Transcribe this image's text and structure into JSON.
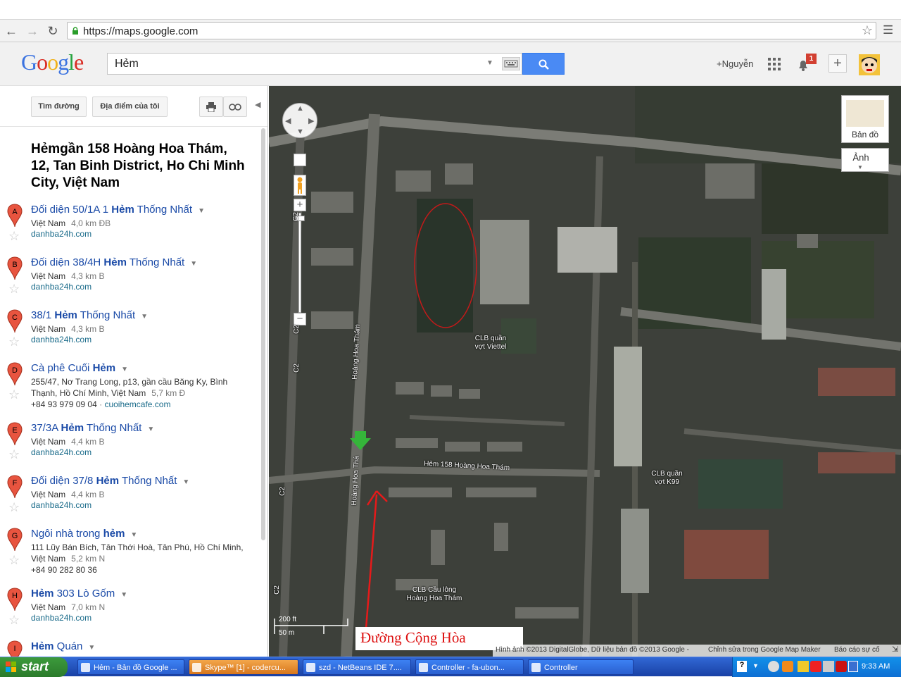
{
  "browser": {
    "url": "https://maps.google.com",
    "back_icon": "back-arrow-icon",
    "forward_icon": "forward-arrow-icon",
    "reload_icon": "reload-icon",
    "star_icon": "bookmark-star-icon",
    "menu_icon": "wrench-menu-icon"
  },
  "header": {
    "logo": "Google",
    "search_value": "Hẻm",
    "user": "+Nguyễn",
    "notification_count": "1"
  },
  "toolbar": {
    "directions": "Tìm đường",
    "my_places": "Địa điểm của tôi"
  },
  "results": {
    "headline": "Hẻmgần 158 Hoàng Hoa Thám, 12, Tan Binh District, Ho Chi Minh City, Việt Nam",
    "items": [
      {
        "marker": "A",
        "pre": "Đối diện 50/1A 1 ",
        "bold": "Hẻm",
        "post": " Thống Nhất",
        "addr": "Việt Nam",
        "dist": "4,0 km ĐB",
        "extra": "",
        "link": "danhba24h.com"
      },
      {
        "marker": "B",
        "pre": "Đối diện 38/4H ",
        "bold": "Hẻm",
        "post": " Thống Nhất",
        "addr": "Việt Nam",
        "dist": "4,3 km B",
        "extra": "",
        "link": "danhba24h.com"
      },
      {
        "marker": "C",
        "pre": "38/1 ",
        "bold": "Hẻm",
        "post": " Thống Nhất",
        "addr": "Việt Nam",
        "dist": "4,3 km B",
        "extra": "",
        "link": "danhba24h.com"
      },
      {
        "marker": "D",
        "pre": "Cà phê Cuối ",
        "bold": "Hẻm",
        "post": "",
        "addr": "255/47, Nơ Trang Long, p13, gần cầu Băng Ky, Bình Thạnh, Hồ Chí Minh, Việt Nam",
        "dist": "5,7 km Đ",
        "extra": "+84 93 979 09 04",
        "link": "cuoihemcafe.com"
      },
      {
        "marker": "E",
        "pre": "37/3A ",
        "bold": "Hẻm",
        "post": " Thống Nhất",
        "addr": "Việt Nam",
        "dist": "4,4 km B",
        "extra": "",
        "link": "danhba24h.com"
      },
      {
        "marker": "F",
        "pre": "Đối diện 37/8 ",
        "bold": "Hẻm",
        "post": " Thống Nhất",
        "addr": "Việt Nam",
        "dist": "4,4 km B",
        "extra": "",
        "link": "danhba24h.com"
      },
      {
        "marker": "G",
        "pre": "Ngôi nhà trong ",
        "bold": "hẻm",
        "post": "",
        "addr": "111 Lũy Bán Bích, Tân Thới Hoà, Tân Phú, Hồ Chí Minh, Việt Nam",
        "dist": "5,2 km N",
        "extra": "+84 90 282 80 36",
        "link": ""
      },
      {
        "marker": "H",
        "pre": "",
        "bold": "Hẻm",
        "post": " 303 Lò Gốm",
        "addr": "Việt Nam",
        "dist": "7,0 km N",
        "extra": "",
        "link": "danhba24h.com"
      },
      {
        "marker": "I",
        "pre": "",
        "bold": "Hẻm",
        "post": " Quán",
        "addr": "",
        "dist": "",
        "extra": "",
        "link": ""
      }
    ]
  },
  "map": {
    "map_button": "Bản đồ",
    "photo_button": "Ảnh",
    "labels": {
      "club_viettel": "CLB quần vợt Viettel",
      "club_k99": "CLB quần vợt K99",
      "club_badminton": "CLB Cầu lông Hoàng Hoa Thám",
      "street_hem": "Hẻm 158 Hoàng Hoa Thám",
      "street_hht": "Hoàng Hoa Thám",
      "street_hht2": "Hoàng Hoa Thá",
      "road_c2": "C2"
    },
    "scale_ft": "200 ft",
    "scale_m": "50 m",
    "annotation": "Đường Cộng Hòa",
    "copyright": "Hình ảnh ©2013 DigitalGlobe, Dữ liệu bản đồ ©2013 Google -",
    "edit_link": "Chỉnh sửa trong Google Map Maker",
    "report_link": "Báo cáo sự cố"
  },
  "taskbar": {
    "start": "start",
    "tasks": [
      {
        "label": "Hẻm - Bản đồ Google ...",
        "color": "#3c81f3"
      },
      {
        "label": "Skype™ [1] - codercu...",
        "color": "#e8882a"
      },
      {
        "label": "szd - NetBeans IDE 7....",
        "color": "#3c81f3"
      },
      {
        "label": "Controller - fa-ubon...",
        "color": "#3c81f3"
      },
      {
        "label": "Controller",
        "color": "#3c81f3"
      }
    ],
    "clock": "9:33 AM"
  }
}
